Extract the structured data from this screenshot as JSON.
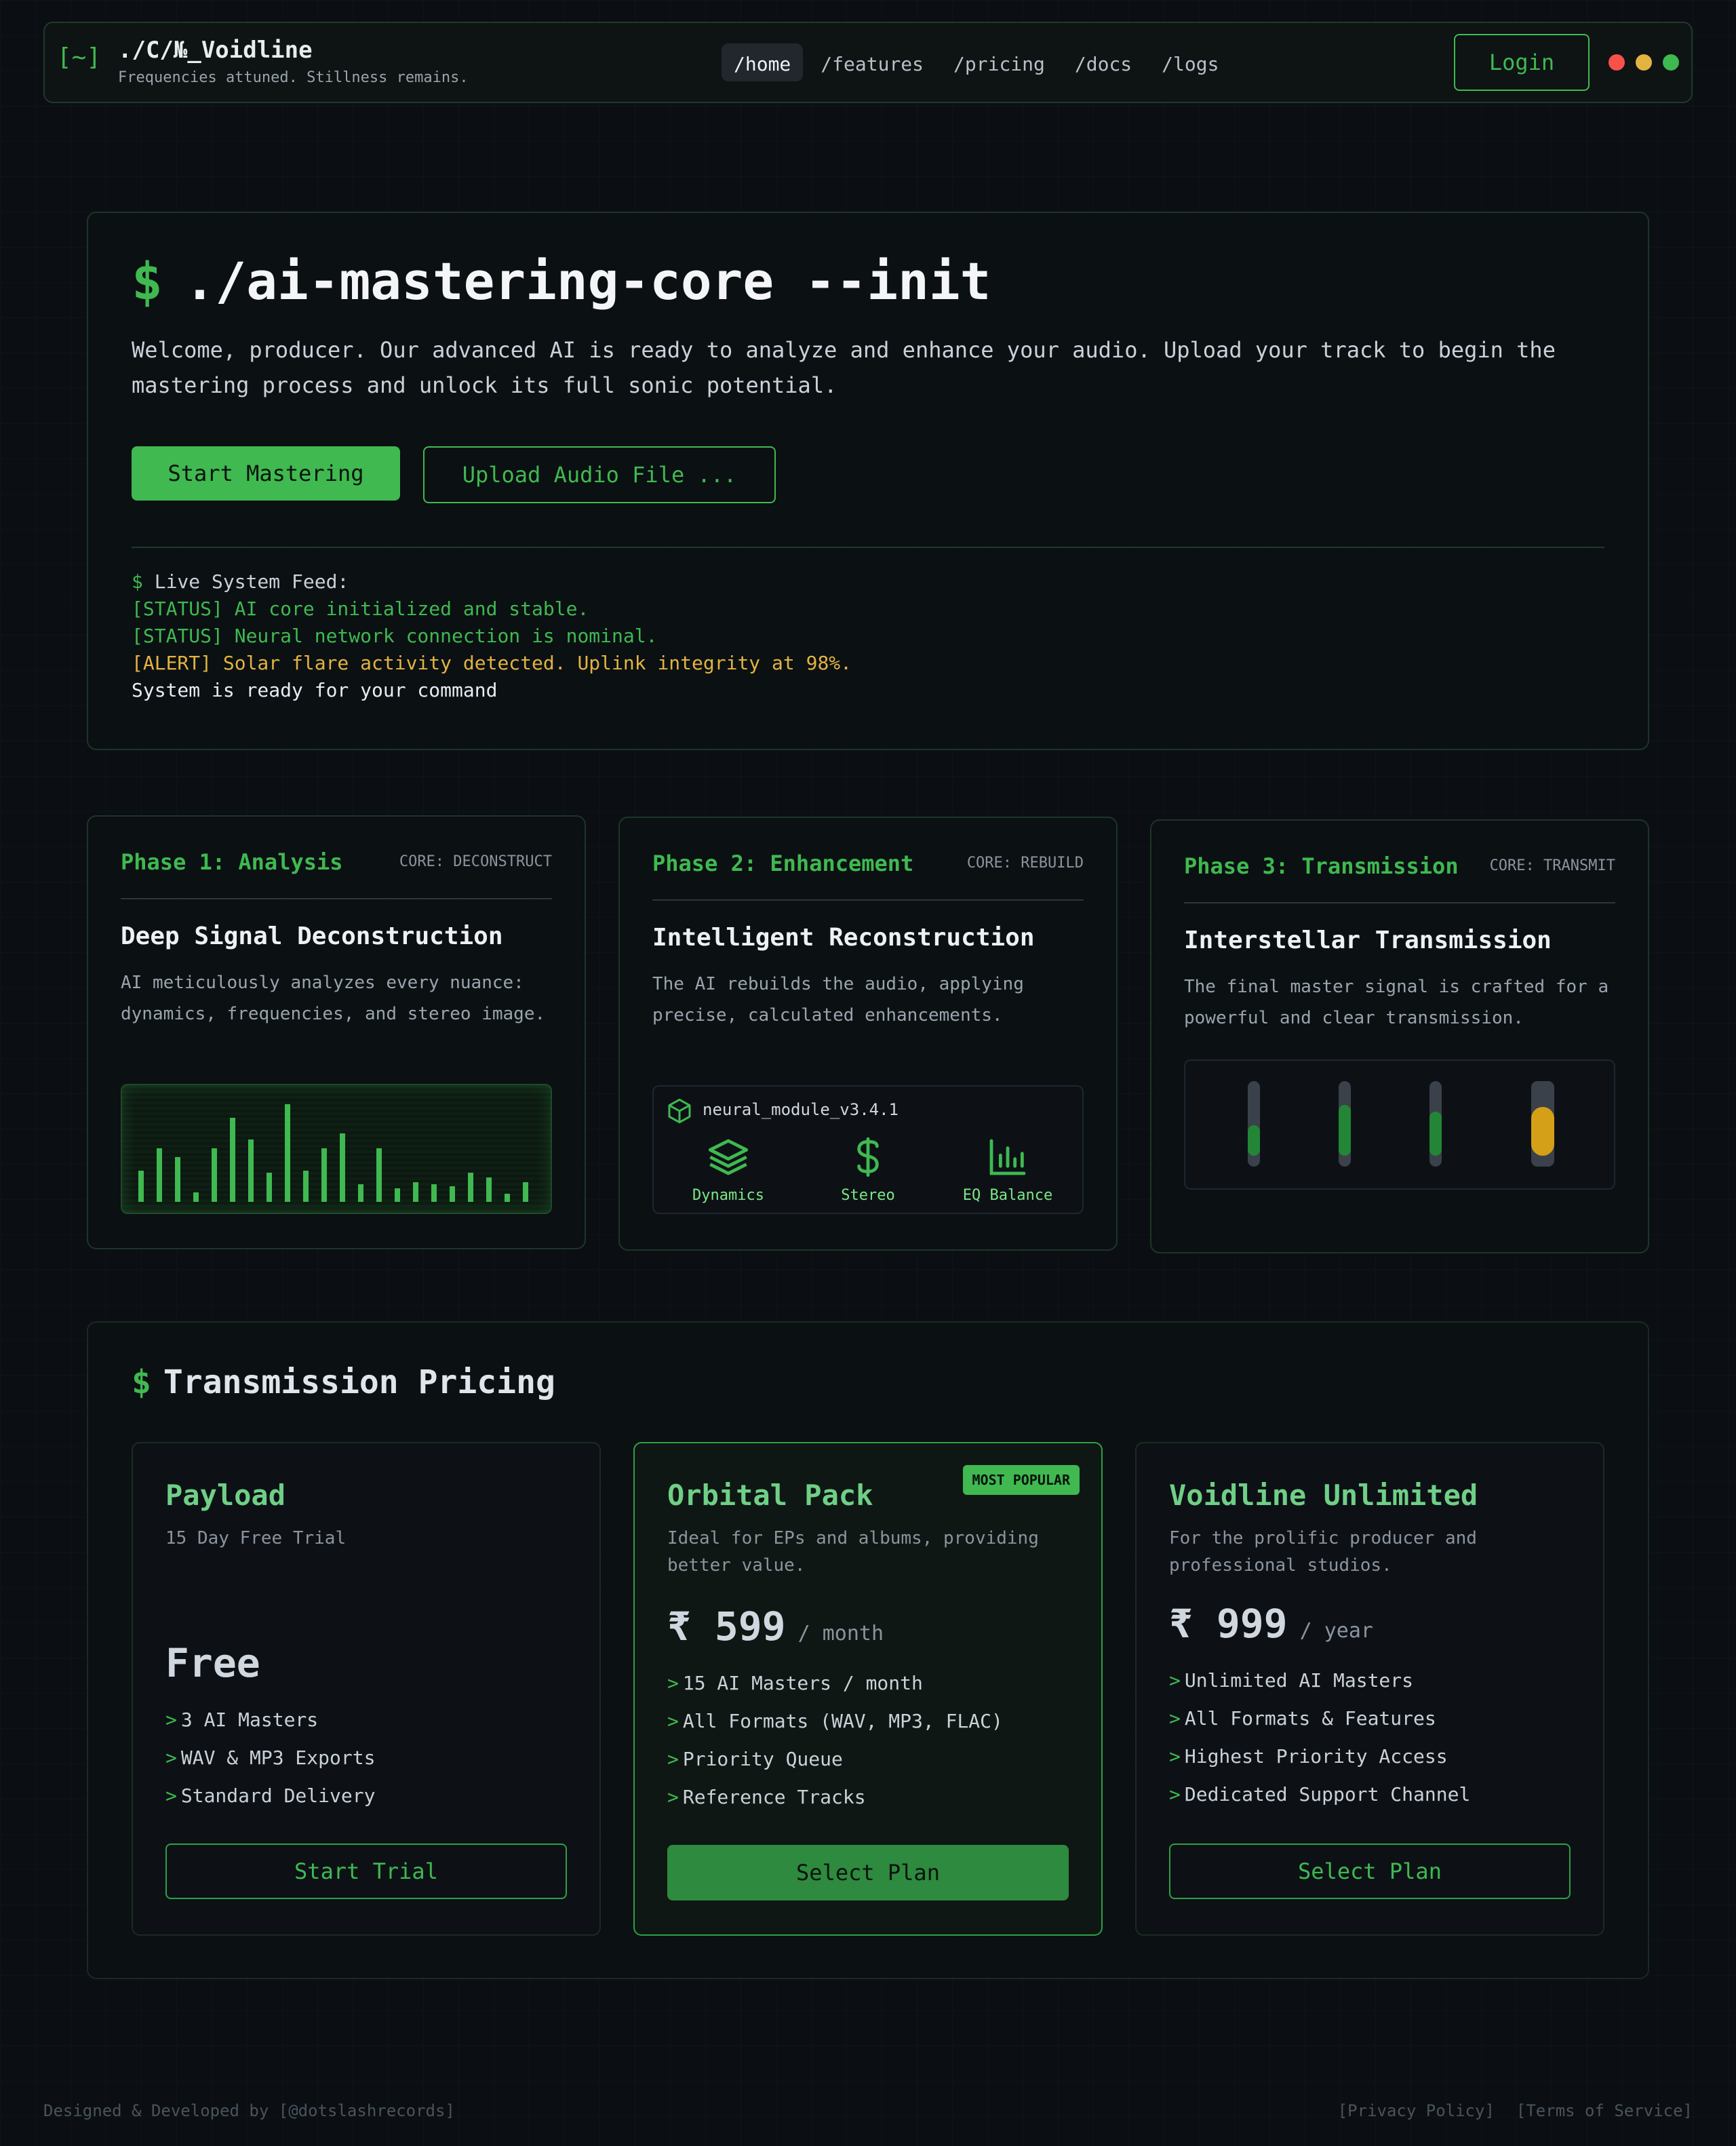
{
  "nav": {
    "logo_glyph": "[~]",
    "brand": "./C/№_Voidline",
    "tagline": "Frequencies attuned. Stillness remains.",
    "links": [
      "/home",
      "/features",
      "/pricing",
      "/docs",
      "/logs"
    ],
    "active_link": "/home",
    "login_label": "Login",
    "window_dots": [
      "#f85149",
      "#e3b341",
      "#3fb950"
    ]
  },
  "hero": {
    "prompt": "$",
    "command": "./ai-mastering-core --init",
    "intro": "Welcome, producer. Our advanced AI is ready to analyze and enhance your audio. Upload your track to begin the mastering process and unlock its full sonic potential.",
    "primary_button": "Start Mastering",
    "upload_button": "Upload Audio File ...",
    "feed": {
      "prompt": "$",
      "header": "Live System Feed:",
      "lines": [
        "[STATUS] AI core initialized and stable.",
        "[STATUS] Neural network connection is nominal.",
        "[ALERT] Solar flare activity detected. Uplink integrity at 98%."
      ],
      "ready": "System is ready for your command"
    }
  },
  "phases": [
    {
      "title": "Phase 1: Analysis",
      "core": "CORE: DECONSTRUCT",
      "heading": "Deep Signal Deconstruction",
      "description": "AI meticulously analyzes every nuance: dynamics, frequencies, and stereo image.",
      "spectrum_levels": [
        0.32,
        0.55,
        0.46,
        0.1,
        0.55,
        0.86,
        0.64,
        0.3,
        1.0,
        0.32,
        0.55,
        0.7,
        0.18,
        0.55,
        0.14,
        0.2,
        0.18,
        0.16,
        0.3,
        0.25,
        0.08,
        0.2
      ]
    },
    {
      "title": "Phase 2: Enhancement",
      "core": "CORE: REBUILD",
      "heading": "Intelligent Reconstruction",
      "description": "The AI rebuilds the audio, applying precise, calculated enhancements.",
      "module_name": "neural_module_v3.4.1",
      "module_icon": "cube-icon",
      "modules": [
        {
          "label": "Dynamics",
          "icon": "layers-icon"
        },
        {
          "label": "Stereo",
          "icon": "dollar-icon"
        },
        {
          "label": "EQ Balance",
          "icon": "bar-chart-icon"
        }
      ]
    },
    {
      "title": "Phase 3: Transmission",
      "core": "CORE: TRANSMIT",
      "heading": "Interstellar Transmission",
      "description": "The final master signal is crafted for a powerful and clear transmission.",
      "meter_levels": [
        0.45,
        0.75,
        0.65,
        0.72
      ]
    }
  ],
  "pricing": {
    "prompt": "$",
    "title": "Transmission Pricing",
    "plans": [
      {
        "name": "Payload",
        "subtitle": "15 Day Free Trial",
        "price": "Free",
        "period": "",
        "features": [
          "3 AI Masters",
          "WAV & MP3 Exports",
          "Standard Delivery"
        ],
        "button": "Start Trial"
      },
      {
        "name": "Orbital Pack",
        "badge": "MOST POPULAR",
        "subtitle": "Ideal for EPs and albums, providing better value.",
        "price": "₹ 599",
        "period": "/ month",
        "features": [
          "15 AI Masters / month",
          "All Formats (WAV, MP3, FLAC)",
          "Priority Queue",
          "Reference Tracks"
        ],
        "button": "Select Plan"
      },
      {
        "name": "Voidline Unlimited",
        "subtitle": "For the prolific producer and professional studios.",
        "price": "₹ 999",
        "period": "/ year",
        "features": [
          "Unlimited AI Masters",
          "All Formats & Features",
          "Highest Priority Access",
          "Dedicated Support Channel"
        ],
        "button": "Select Plan"
      }
    ]
  },
  "footer": {
    "credit": "Designed & Developed by [@dotslashrecords]",
    "privacy": "[Privacy Policy]",
    "terms": "[Terms of Service]"
  }
}
